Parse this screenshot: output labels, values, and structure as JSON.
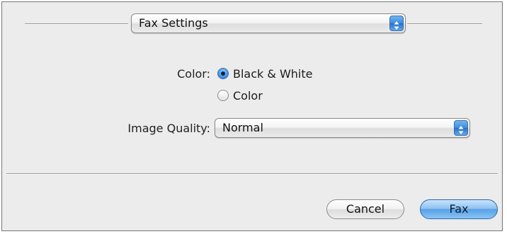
{
  "panel_popup": {
    "selected": "Fax Settings"
  },
  "color_setting": {
    "label": "Color:",
    "options": [
      {
        "label": "Black & White",
        "selected": true
      },
      {
        "label": "Color",
        "selected": false
      }
    ]
  },
  "image_quality": {
    "label": "Image Quality:",
    "selected": "Normal"
  },
  "buttons": {
    "cancel": "Cancel",
    "fax": "Fax"
  },
  "colors": {
    "accent_blue": "#3d8bdc",
    "window_bg": "#ececec"
  }
}
